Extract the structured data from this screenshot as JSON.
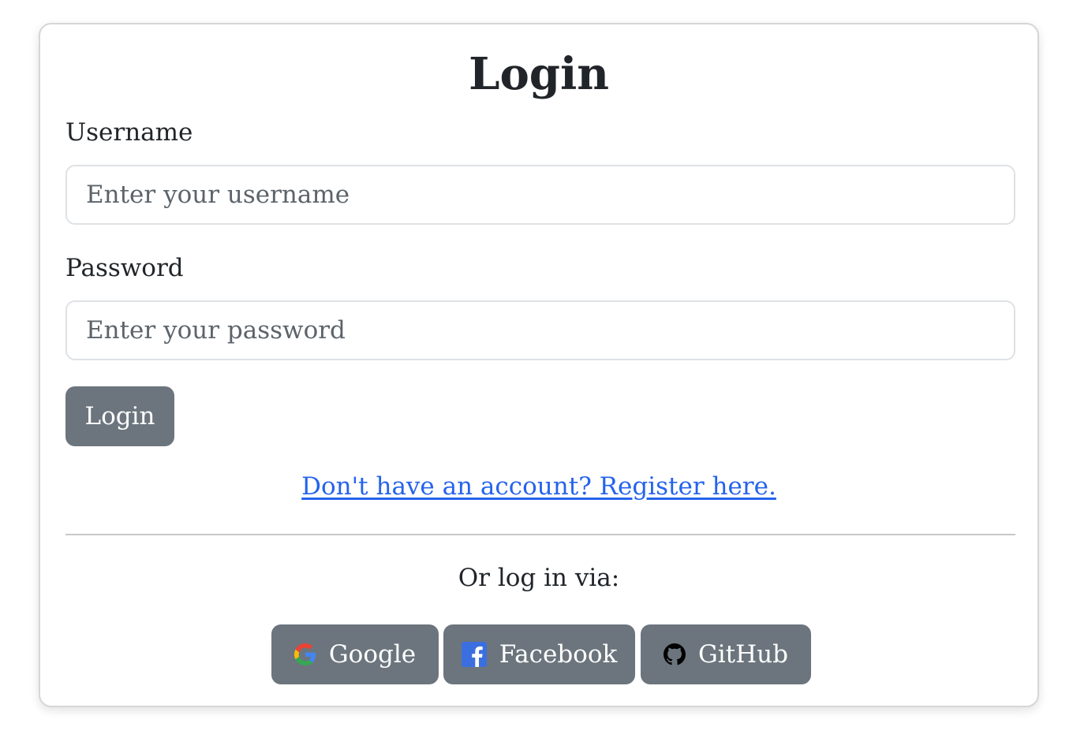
{
  "form": {
    "title": "Login",
    "username_label": "Username",
    "username_placeholder": "Enter your username",
    "password_label": "Password",
    "password_placeholder": "Enter your password",
    "submit_label": "Login",
    "register_link": "Don't have an account? Register here."
  },
  "social": {
    "prompt": "Or log in via:",
    "buttons": [
      {
        "label": "Google",
        "icon": "google-icon"
      },
      {
        "label": "Facebook",
        "icon": "facebook-icon"
      },
      {
        "label": "GitHub",
        "icon": "github-icon"
      }
    ]
  },
  "colors": {
    "button_bg": "#6c757d",
    "link": "#2563eb",
    "facebook": "#3b6fe0"
  }
}
